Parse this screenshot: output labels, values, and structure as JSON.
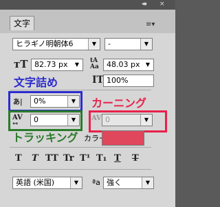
{
  "panel": {
    "tab_label": "文字",
    "collapse_glyph": "◂◂",
    "close_glyph": "×",
    "menu_glyph": "≡▾"
  },
  "font": {
    "family": "ヒラギノ明朝体6",
    "style": "-"
  },
  "size": {
    "font_size": "82.73 px",
    "leading": "48.03 px",
    "vertical_scale": "100%"
  },
  "spacing": {
    "tsume": "0%",
    "tracking": "0",
    "kerning": "0"
  },
  "color": {
    "label": "カラー：",
    "swatch": "#e0475c"
  },
  "annotations": {
    "mojitsume": "文字詰め",
    "kerning": "カーニング",
    "tracking": "トラッキング",
    "blue": "#2b2bd0",
    "red": "#e8214a",
    "green": "#2a7a2a"
  },
  "style_buttons": [
    "T",
    "T",
    "TT",
    "Tr",
    "T¹",
    "T₁",
    "T",
    "T"
  ],
  "language": {
    "value": "英語 (米国)",
    "antialias_icon_label": "ªa",
    "antialias": "強く"
  }
}
